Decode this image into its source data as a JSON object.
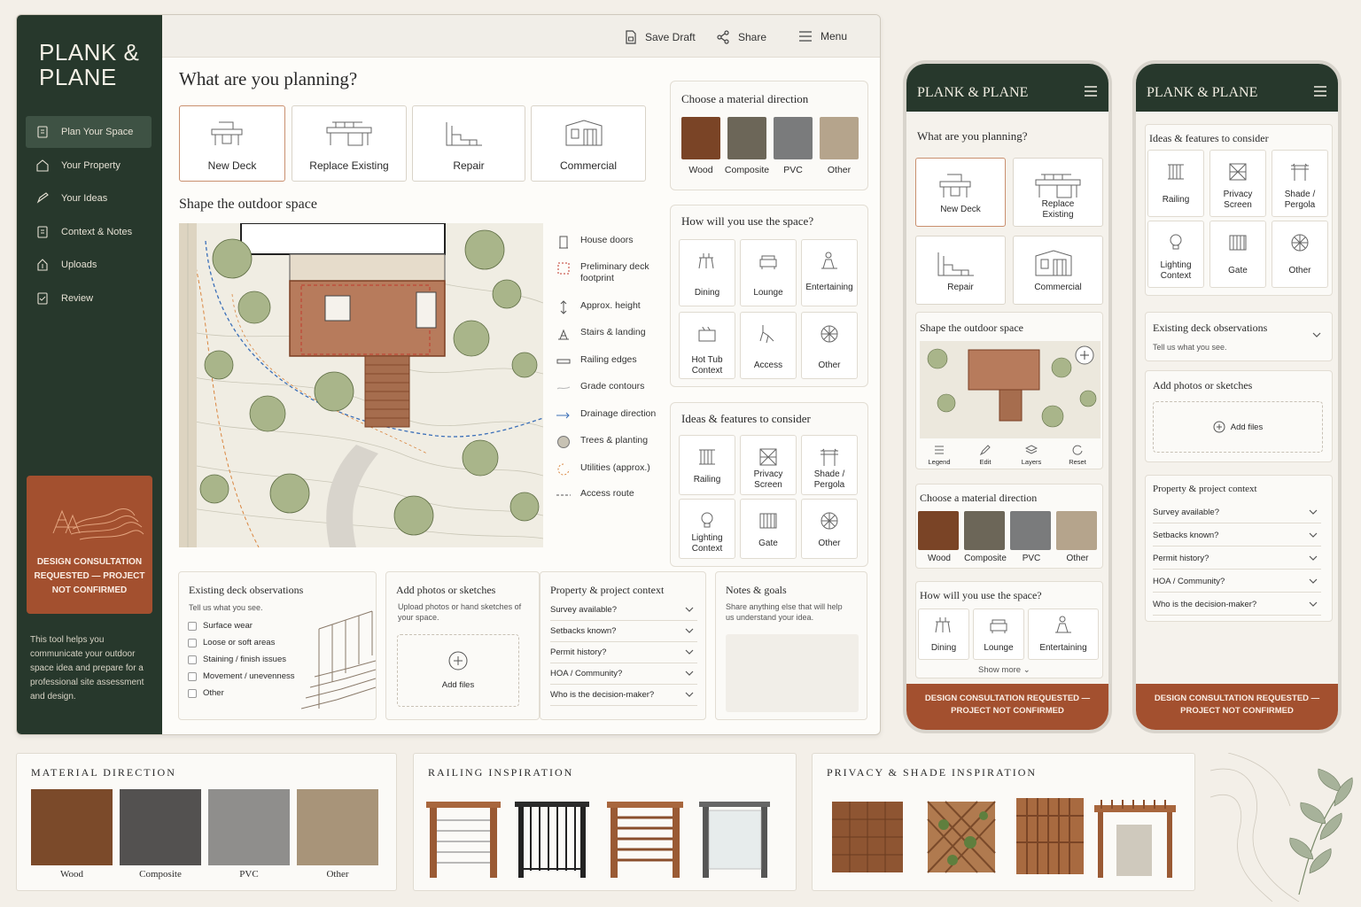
{
  "brand": "PLANK &\nPLANE",
  "brand_short": "PLANK & PLANE",
  "sidebar": {
    "items": [
      {
        "label": "Plan Your Space",
        "icon": "plan-icon",
        "active": true
      },
      {
        "label": "Your Property",
        "icon": "house-icon"
      },
      {
        "label": "Your Ideas",
        "icon": "pencil-icon"
      },
      {
        "label": "Context & Notes",
        "icon": "notes-icon"
      },
      {
        "label": "Uploads",
        "icon": "upload-icon"
      },
      {
        "label": "Review",
        "icon": "review-icon"
      }
    ],
    "consult_banner": "DESIGN CONSULTATION REQUESTED — PROJECT NOT CONFIRMED",
    "note": "This tool helps you communicate your outdoor space idea and prepare for a professional site assessment and design."
  },
  "toolbar": {
    "save": "Save Draft",
    "share": "Share",
    "menu": "Menu"
  },
  "planning": {
    "title": "What are you planning?",
    "options": [
      {
        "label": "New Deck",
        "selected": true
      },
      {
        "label": "Replace Existing"
      },
      {
        "label": "Repair"
      },
      {
        "label": "Commercial"
      }
    ]
  },
  "shape": {
    "title": "Shape the outdoor space",
    "legend": [
      {
        "label": "House doors",
        "icon": "door-icon"
      },
      {
        "label": "Preliminary deck footprint",
        "icon": "dashed-square-icon"
      },
      {
        "label": "Approx. height",
        "icon": "height-arrow-icon"
      },
      {
        "label": "Stairs & landing",
        "icon": "stairs-icon"
      },
      {
        "label": "Railing edges",
        "icon": "railing-edge-icon"
      },
      {
        "label": "Grade contours",
        "icon": "contour-icon"
      },
      {
        "label": "Drainage direction",
        "icon": "drainage-arrow-icon"
      },
      {
        "label": "Trees & planting",
        "icon": "tree-icon"
      },
      {
        "label": "Utilities (approx.)",
        "icon": "utility-icon"
      },
      {
        "label": "Access route",
        "icon": "access-route-icon"
      }
    ]
  },
  "material": {
    "title": "Choose a material direction",
    "options": [
      {
        "label": "Wood",
        "color": "#7a4426"
      },
      {
        "label": "Composite",
        "color": "#6c6658"
      },
      {
        "label": "PVC",
        "color": "#7a7b7c"
      },
      {
        "label": "Other",
        "color": "#b5a48c"
      }
    ]
  },
  "use": {
    "title": "How will you use the space?",
    "options": [
      "Dining",
      "Lounge",
      "Entertaining",
      "Hot Tub Context",
      "Access",
      "Other"
    ],
    "show_more": "Show more"
  },
  "ideas": {
    "title": "Ideas & features to consider",
    "options": [
      "Railing",
      "Privacy Screen",
      "Shade / Pergola",
      "Lighting Context",
      "Gate",
      "Other"
    ]
  },
  "observations": {
    "title": "Existing deck observations",
    "subtitle": "Tell us what you see.",
    "checks": [
      "Surface wear",
      "Loose or soft areas",
      "Staining / finish issues",
      "Movement / unevenness",
      "Other"
    ]
  },
  "uploads": {
    "title": "Add photos or sketches",
    "subtitle": "Upload photos or hand sketches of your space.",
    "button": "Add files"
  },
  "context": {
    "title": "Property & project context",
    "questions": [
      "Survey available?",
      "Setbacks known?",
      "Permit history?",
      "HOA / Community?",
      "Who is the decision-maker?"
    ]
  },
  "notes": {
    "title": "Notes & goals",
    "subtitle": "Share anything else that will help us understand your idea."
  },
  "mobile": {
    "map_tools": [
      "Legend",
      "Edit",
      "Layers",
      "Reset"
    ],
    "consult_banner": "DESIGN CONSULTATION REQUESTED —\nPROJECT NOT CONFIRMED"
  },
  "inspiration": {
    "material_title": "MATERIAL DIRECTION",
    "materials": [
      {
        "label": "Wood",
        "color": "#7b4a2a"
      },
      {
        "label": "Composite",
        "color": "#535150"
      },
      {
        "label": "PVC",
        "color": "#8f8e8c"
      },
      {
        "label": "Other",
        "color": "#a89479"
      }
    ],
    "railing_title": "RAILING INSPIRATION",
    "privacy_title": "PRIVACY & SHADE INSPIRATION"
  }
}
